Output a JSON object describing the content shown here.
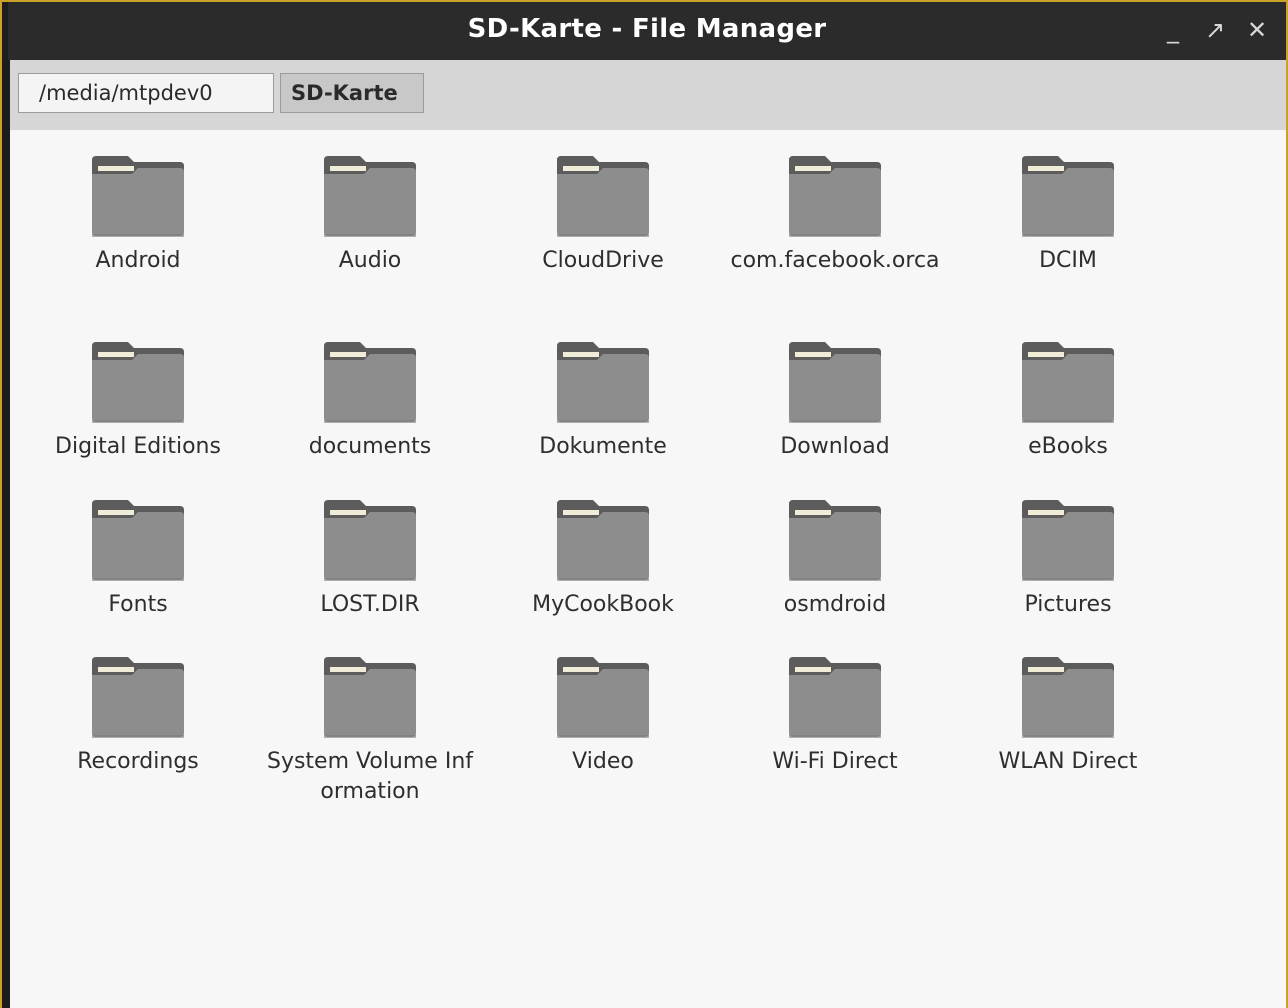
{
  "window": {
    "title": "SD-Karte - File Manager",
    "controls": {
      "minimize": "_",
      "maximize": "↗",
      "close": "✕"
    }
  },
  "pathbar": {
    "crumbs": [
      "/media/mtpdev0",
      "SD-Karte"
    ]
  },
  "colors": {
    "folder_body": "#8d8d8d",
    "folder_tab": "#5c5c5c",
    "folder_paper": "#f1ecd8",
    "accent_border": "#c9a227"
  },
  "files": [
    {
      "name": "Android",
      "type": "folder",
      "icon": "folder-icon"
    },
    {
      "name": "Audio",
      "type": "folder",
      "icon": "folder-icon"
    },
    {
      "name": "CloudDrive",
      "type": "folder",
      "icon": "folder-icon"
    },
    {
      "name": "com.facebook.orca",
      "type": "folder",
      "icon": "folder-icon"
    },
    {
      "name": "DCIM",
      "type": "folder",
      "icon": "folder-icon"
    },
    {
      "name": "Digital Editions",
      "type": "folder",
      "icon": "folder-icon"
    },
    {
      "name": "documents",
      "type": "folder",
      "icon": "folder-icon"
    },
    {
      "name": "Dokumente",
      "type": "folder",
      "icon": "folder-icon"
    },
    {
      "name": "Download",
      "type": "folder",
      "icon": "folder-icon"
    },
    {
      "name": "eBooks",
      "type": "folder",
      "icon": "folder-icon"
    },
    {
      "name": "Fonts",
      "type": "folder",
      "icon": "folder-icon"
    },
    {
      "name": "LOST.DIR",
      "type": "folder",
      "icon": "folder-icon"
    },
    {
      "name": "MyCookBook",
      "type": "folder",
      "icon": "folder-icon"
    },
    {
      "name": "osmdroid",
      "type": "folder",
      "icon": "folder-icon"
    },
    {
      "name": "Pictures",
      "type": "folder",
      "icon": "folder-icon"
    },
    {
      "name": "Recordings",
      "type": "folder",
      "icon": "folder-icon"
    },
    {
      "name": "System Volume Information",
      "type": "folder",
      "icon": "folder-icon"
    },
    {
      "name": "Video",
      "type": "folder",
      "icon": "folder-icon"
    },
    {
      "name": "Wi-Fi Direct",
      "type": "folder",
      "icon": "folder-icon"
    },
    {
      "name": "WLAN Direct",
      "type": "folder",
      "icon": "folder-icon"
    }
  ]
}
